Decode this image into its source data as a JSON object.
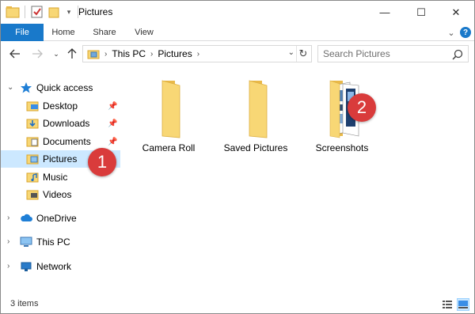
{
  "window": {
    "title": "Pictures",
    "controls": {
      "minimize": "—",
      "maximize": "☐",
      "close": "✕"
    }
  },
  "ribbon": {
    "tabs": [
      "File",
      "Home",
      "Share",
      "View"
    ],
    "collapse_glyph": "⌄",
    "help_glyph": "?"
  },
  "address": {
    "crumbs": [
      "This PC",
      "Pictures"
    ],
    "search_placeholder": "Search Pictures"
  },
  "nav": {
    "quick_access": "Quick access",
    "quick_items": [
      {
        "label": "Desktop",
        "pinned": true,
        "icon": "desktop-folder-icon"
      },
      {
        "label": "Downloads",
        "pinned": true,
        "icon": "downloads-folder-icon"
      },
      {
        "label": "Documents",
        "pinned": true,
        "icon": "documents-folder-icon"
      },
      {
        "label": "Pictures",
        "pinned": false,
        "icon": "pictures-folder-icon",
        "selected": true
      },
      {
        "label": "Music",
        "pinned": false,
        "icon": "music-folder-icon"
      },
      {
        "label": "Videos",
        "pinned": false,
        "icon": "videos-folder-icon"
      }
    ],
    "onedrive": "OneDrive",
    "this_pc": "This PC",
    "network": "Network"
  },
  "content": {
    "folders": [
      {
        "label": "Camera Roll",
        "icon": "folder-icon"
      },
      {
        "label": "Saved Pictures",
        "icon": "folder-icon"
      },
      {
        "label": "Screenshots",
        "icon": "folder-with-images-icon"
      }
    ]
  },
  "badges": [
    "1",
    "2"
  ],
  "status": {
    "item_count": "3 items"
  },
  "colors": {
    "file_tab": "#1979ca",
    "selection": "#cce8ff",
    "folder": "#f8d775",
    "badge": "#d93b3b"
  }
}
